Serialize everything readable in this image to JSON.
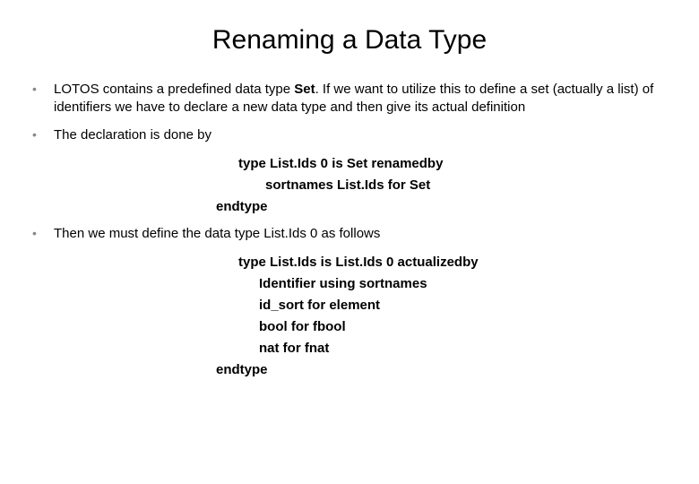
{
  "title": "Renaming a Data Type",
  "bullets": [
    {
      "pre": "LOTOS contains a predefined data type ",
      "bold": "Set",
      "post": ".  If we want to utilize this to define a set (actually a list) of identifiers we have to declare a new data type and then give its actual definition"
    },
    {
      "pre": "The declaration is done by",
      "bold": "",
      "post": ""
    },
    {
      "pre": "Then we must define the data type List.Ids 0 as follows",
      "bold": "",
      "post": ""
    }
  ],
  "code1": [
    "type  List.Ids 0 is Set renamedby",
    "sortnames List.Ids for Set",
    "endtype"
  ],
  "code2": [
    "type List.Ids is List.Ids 0 actualizedby",
    "Identifier using sortnames",
    "id_sort for element",
    "bool for fbool",
    "nat for fnat",
    "endtype"
  ]
}
